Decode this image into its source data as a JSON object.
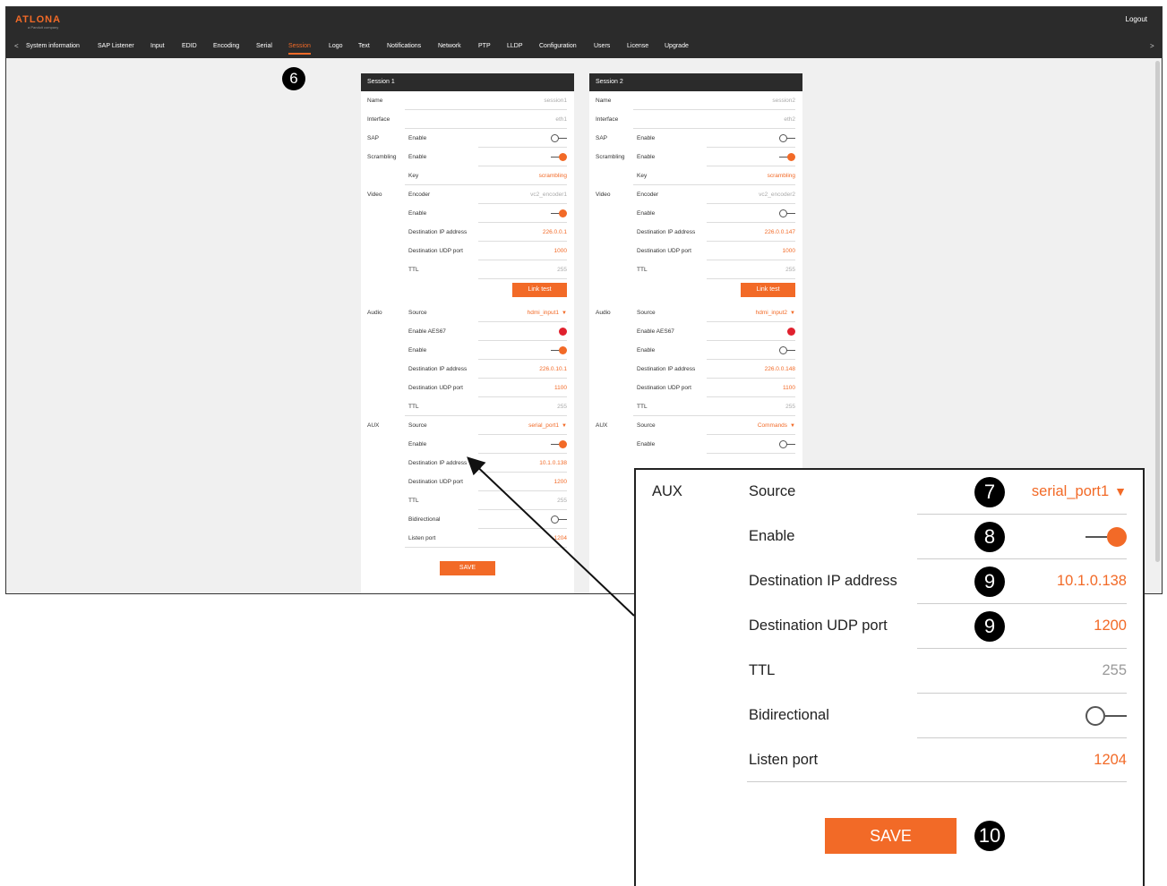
{
  "app": {
    "logo_text": "ATLONA",
    "logo_sub": "a Panduit company",
    "logout": "Logout",
    "nav": [
      "System information",
      "SAP Listener",
      "Input",
      "EDID",
      "Encoding",
      "Serial",
      "Session",
      "Logo",
      "Text",
      "Notifications",
      "Network",
      "PTP",
      "LLDP",
      "Configuration",
      "Users",
      "License",
      "Upgrade"
    ],
    "nav_active": "Session",
    "nav_prev": "<",
    "nav_next": ">"
  },
  "colors": {
    "accent": "#f26a27",
    "header": "#2b2b2b",
    "red": "#e0212e"
  },
  "callouts": {
    "b6": "6",
    "b7": "7",
    "b8": "8",
    "b9a": "9",
    "b9b": "9",
    "b10": "10"
  },
  "session1": {
    "title": "Session 1",
    "name_label": "Name",
    "name": "session1",
    "interface_label": "Interface",
    "interface": "eth1",
    "sap_label": "SAP",
    "sap_enable_label": "Enable",
    "sap_enabled": false,
    "scrambling_label": "Scrambling",
    "scr_enable_label": "Enable",
    "scr_enabled": true,
    "key_label": "Key",
    "key": "scrambling",
    "video_label": "Video",
    "encoder_label": "Encoder",
    "encoder": "vc2_encoder1",
    "video_enable_label": "Enable",
    "video_enabled": true,
    "video_ip_label": "Destination IP address",
    "video_ip": "226.0.0.1",
    "video_udp_label": "Destination UDP port",
    "video_udp": "1000",
    "video_ttl_label": "TTL",
    "video_ttl": "255",
    "link_test": "Link test",
    "audio_label": "Audio",
    "audio_source_label": "Source",
    "audio_source": "hdmi_input1",
    "aes67_label": "Enable AES67",
    "audio_enable_label": "Enable",
    "audio_enabled": true,
    "audio_ip_label": "Destination IP address",
    "audio_ip": "226.0.10.1",
    "audio_udp_label": "Destination UDP port",
    "audio_udp": "1100",
    "audio_ttl_label": "TTL",
    "audio_ttl": "255",
    "aux_label": "AUX",
    "aux_source_label": "Source",
    "aux_source": "serial_port1",
    "aux_enable_label": "Enable",
    "aux_enabled": true,
    "aux_ip_label": "Destination IP address",
    "aux_ip": "10.1.0.138",
    "aux_udp_label": "Destination UDP port",
    "aux_udp": "1200",
    "aux_ttl_label": "TTL",
    "aux_ttl": "255",
    "bidir_label": "Bidirectional",
    "bidir_enabled": false,
    "listen_label": "Listen port",
    "listen": "1204",
    "save": "SAVE"
  },
  "session2": {
    "title": "Session 2",
    "name_label": "Name",
    "name": "session2",
    "interface_label": "Interface",
    "interface": "eth2",
    "sap_label": "SAP",
    "sap_enable_label": "Enable",
    "sap_enabled": false,
    "scrambling_label": "Scrambling",
    "scr_enable_label": "Enable",
    "scr_enabled": true,
    "key_label": "Key",
    "key": "scrambling",
    "video_label": "Video",
    "encoder_label": "Encoder",
    "encoder": "vc2_encoder2",
    "video_enable_label": "Enable",
    "video_enabled": false,
    "video_ip_label": "Destination IP address",
    "video_ip": "226.0.0.147",
    "video_udp_label": "Destination UDP port",
    "video_udp": "1000",
    "video_ttl_label": "TTL",
    "video_ttl": "255",
    "link_test": "Link test",
    "audio_label": "Audio",
    "audio_source_label": "Source",
    "audio_source": "hdmi_input2",
    "aes67_label": "Enable AES67",
    "audio_enable_label": "Enable",
    "audio_enabled": false,
    "audio_ip_label": "Destination IP address",
    "audio_ip": "226.0.0.148",
    "audio_udp_label": "Destination UDP port",
    "audio_udp": "1100",
    "audio_ttl_label": "TTL",
    "audio_ttl": "255",
    "aux_label": "AUX",
    "aux_source_label": "Source",
    "aux_source": "Commands",
    "aux_enable_label": "Enable",
    "aux_enabled": false
  },
  "zoom": {
    "aux_label": "AUX",
    "source_label": "Source",
    "source": "serial_port1",
    "enable_label": "Enable",
    "enabled": true,
    "ip_label": "Destination IP address",
    "ip": "10.1.0.138",
    "udp_label": "Destination UDP port",
    "udp": "1200",
    "ttl_label": "TTL",
    "ttl": "255",
    "bidir_label": "Bidirectional",
    "bidir_enabled": false,
    "listen_label": "Listen port",
    "listen": "1204",
    "save": "SAVE"
  }
}
